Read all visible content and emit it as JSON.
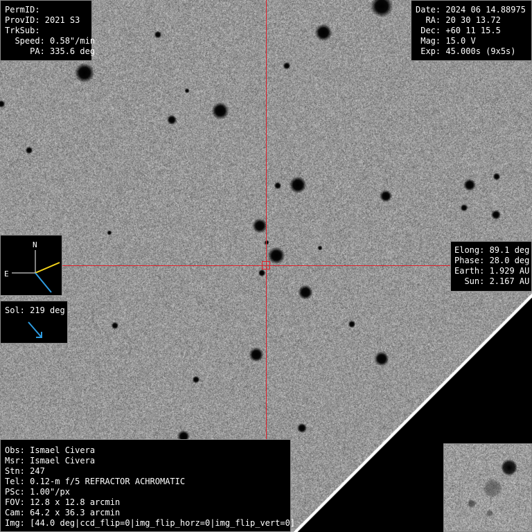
{
  "target_info": {
    "perm_id": "PermID:",
    "prov_id": "ProvID: 2021 S3",
    "trk_sub": "TrkSub:",
    "speed": "  Speed: 0.58\"/min",
    "pa": "     PA: 335.6 deg"
  },
  "observation": {
    "date": "Date: 2024 06 14.88975",
    "ra": "  RA: 20 30 13.72",
    "dec": " Dec: +60 11 15.5",
    "mag": " Mag: 15.0 V",
    "exp": " Exp: 45.000s (9x5s)"
  },
  "geometry": {
    "elong": "Elong: 89.1 deg",
    "phase": "Phase: 28.0 deg",
    "earth": "Earth: 1.929 AU",
    "sun": "  Sun: 2.167 AU"
  },
  "compass": {
    "north_label": "N",
    "east_label": "E",
    "motion_color": "#f2d21a",
    "sun_color": "#2e9be0"
  },
  "solar": {
    "label": "Sol: 219 deg",
    "arrow_color": "#2e9be0"
  },
  "site": {
    "obs": "Obs: Ismael Civera",
    "msr": "Msr: Ismael Civera",
    "stn": "Stn: 247",
    "tel": "Tel: 0.12-m f/5 REFRACTOR ACHROMATIC",
    "psc": "PSc: 1.00\"/px",
    "fov": "FOV: 12.8 x 12.8 arcmin",
    "cam": "Cam: 64.2 x 36.3 arcmin",
    "img": "Img: [44.0 deg|ccd_flip=0|img_flip_horz=0|img_flip_vert=0]"
  },
  "crosshair_color": "#e0202a"
}
